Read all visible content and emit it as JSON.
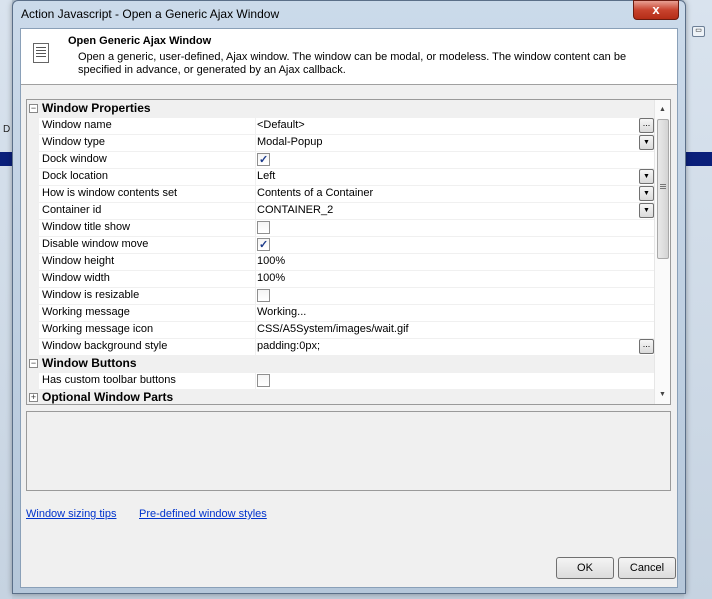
{
  "window": {
    "title": "Action Javascript - Open a Generic Ajax Window",
    "close_label": "x"
  },
  "background": {
    "partial_text": "D",
    "mini_icon": "▭"
  },
  "header": {
    "title": "Open Generic Ajax Window",
    "description": "Open a generic, user-defined, Ajax window. The window can be modal, or modeless. The window content can be specified in advance, or generated by an Ajax callback."
  },
  "grid": {
    "rows": [
      {
        "type": "category",
        "label": "Window Properties",
        "expander": "−"
      },
      {
        "type": "prop",
        "name": "Window name",
        "value": "<Default>",
        "editor": "ellipsis"
      },
      {
        "type": "prop",
        "name": "Window type",
        "value": "Modal-Popup",
        "editor": "dropdown"
      },
      {
        "type": "prop",
        "name": "Dock window",
        "checked": true,
        "editor": "checkbox"
      },
      {
        "type": "prop",
        "name": "Dock location",
        "value": "Left",
        "editor": "dropdown"
      },
      {
        "type": "prop",
        "name": "How is window contents set",
        "value": "Contents of a Container",
        "editor": "dropdown"
      },
      {
        "type": "prop",
        "name": "Container id",
        "value": "CONTAINER_2",
        "editor": "dropdown"
      },
      {
        "type": "prop",
        "name": "Window title show",
        "checked": false,
        "editor": "checkbox"
      },
      {
        "type": "prop",
        "name": "Disable window move",
        "checked": true,
        "editor": "checkbox"
      },
      {
        "type": "prop",
        "name": "Window height",
        "value": "100%",
        "editor": "text"
      },
      {
        "type": "prop",
        "name": "Window width",
        "value": "100%",
        "editor": "text"
      },
      {
        "type": "prop",
        "name": "Window is resizable",
        "checked": false,
        "editor": "checkbox"
      },
      {
        "type": "prop",
        "name": "Working message",
        "value": "Working...",
        "editor": "text"
      },
      {
        "type": "prop",
        "name": "Working message icon",
        "value": "CSS/A5System/images/wait.gif",
        "editor": "text"
      },
      {
        "type": "prop",
        "name": "Window background style",
        "value": "padding:0px;",
        "editor": "ellipsis"
      },
      {
        "type": "category",
        "label": "Window Buttons",
        "expander": "−"
      },
      {
        "type": "prop",
        "name": "Has custom toolbar buttons",
        "checked": false,
        "editor": "checkbox"
      },
      {
        "type": "category",
        "label": "Optional Window Parts",
        "expander": "+"
      }
    ],
    "scroll_up_icon": "▲",
    "scroll_down_icon": "▼",
    "dropdown_icon": "▼",
    "ellipsis_icon": "..."
  },
  "links": {
    "sizing_tips": "Window sizing tips",
    "predefined_styles": "Pre-defined window styles"
  },
  "buttons": {
    "ok": "OK",
    "cancel": "Cancel"
  }
}
